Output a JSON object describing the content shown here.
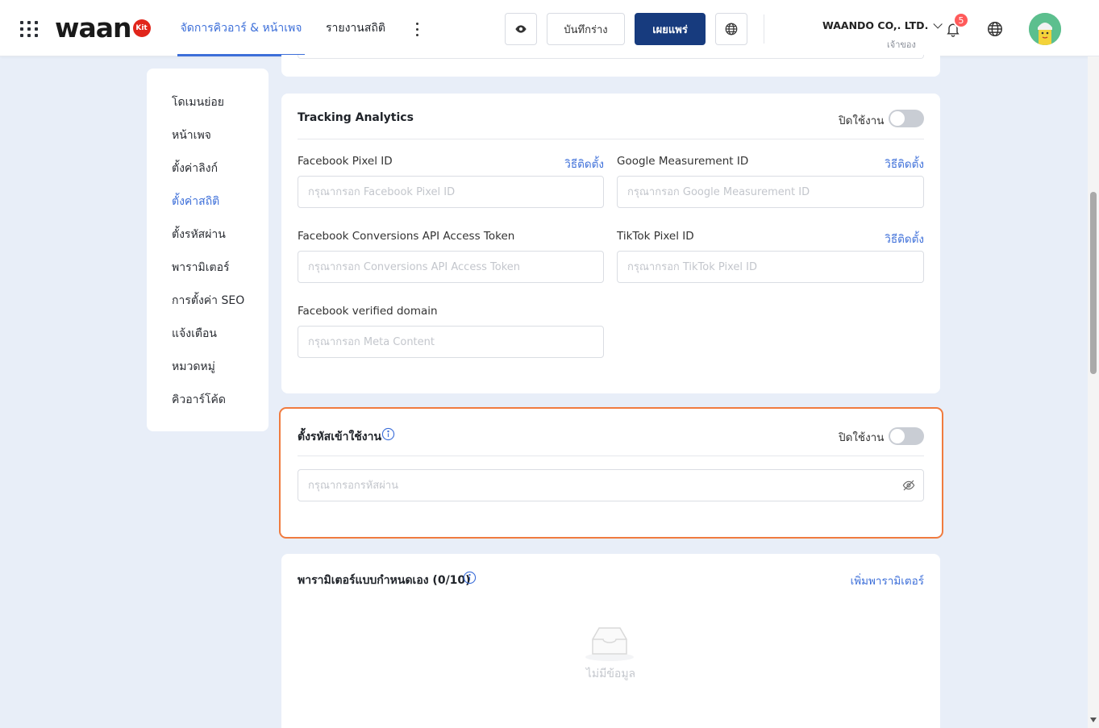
{
  "header": {
    "logo_text": "waan",
    "logo_badge": "Kit",
    "tabs": [
      {
        "label": "จัดการคิวอาร์ & หน้าเพจ",
        "active": true
      },
      {
        "label": "รายงานสถิติ",
        "active": false
      }
    ],
    "preview_icon": "eye-icon",
    "save_draft_label": "บันทึกร่าง",
    "publish_label": "เผยแพร่",
    "publish_color": "#173b7e",
    "language_icon": "globe-icon",
    "company_name": "WAANDO CO,. LTD.",
    "company_role": "เจ้าของ",
    "notification_count": "5",
    "accent_color": "#3d6fd9"
  },
  "sidebar": {
    "items": [
      {
        "label": "โดเมนย่อย",
        "active": false
      },
      {
        "label": "หน้าเพจ",
        "active": false
      },
      {
        "label": "ตั้งค่าลิงก์",
        "active": false
      },
      {
        "label": "ตั้งค่าสถิติ",
        "active": true
      },
      {
        "label": "ตั้งรหัสผ่าน",
        "active": false
      },
      {
        "label": "พารามิเตอร์",
        "active": false
      },
      {
        "label": "การตั้งค่า SEO",
        "active": false
      },
      {
        "label": "แจ้งเตือน",
        "active": false
      },
      {
        "label": "หมวดหมู่",
        "active": false
      },
      {
        "label": "คิวอาร์โค้ด",
        "active": false
      }
    ]
  },
  "tracking": {
    "title": "Tracking Analytics",
    "toggle_label": "ปิดใช้งาน",
    "enabled": false,
    "fields": {
      "fb_pixel": {
        "label": "Facebook Pixel ID",
        "link": "วิธีติดตั้ง",
        "placeholder": "กรุณากรอก Facebook Pixel ID",
        "value": ""
      },
      "google_mid": {
        "label": "Google Measurement ID",
        "link": "วิธีติดตั้ง",
        "placeholder": "กรุณากรอก Google Measurement ID",
        "value": ""
      },
      "fb_capi": {
        "label": "Facebook Conversions API Access Token",
        "placeholder": "กรุณากรอก Conversions API Access Token",
        "value": ""
      },
      "tiktok": {
        "label": "TikTok Pixel ID",
        "link": "วิธีติดตั้ง",
        "placeholder": "กรุณากรอก TikTok Pixel ID",
        "value": ""
      },
      "fb_domain": {
        "label": "Facebook verified domain",
        "placeholder": "กรุณากรอก Meta Content",
        "value": ""
      }
    }
  },
  "password": {
    "title": "ตั้งรหัสเข้าใช้งาน",
    "toggle_label": "ปิดใช้งาน",
    "enabled": false,
    "placeholder": "กรุณากรอกรหัสผ่าน",
    "value": "",
    "highlight_color": "#f07b3f"
  },
  "params": {
    "title": "พารามิเตอร์แบบกำหนดเอง (0/10)",
    "add_label": "เพิ่มพารามิเตอร์",
    "empty_text": "ไม่มีข้อมูล"
  }
}
